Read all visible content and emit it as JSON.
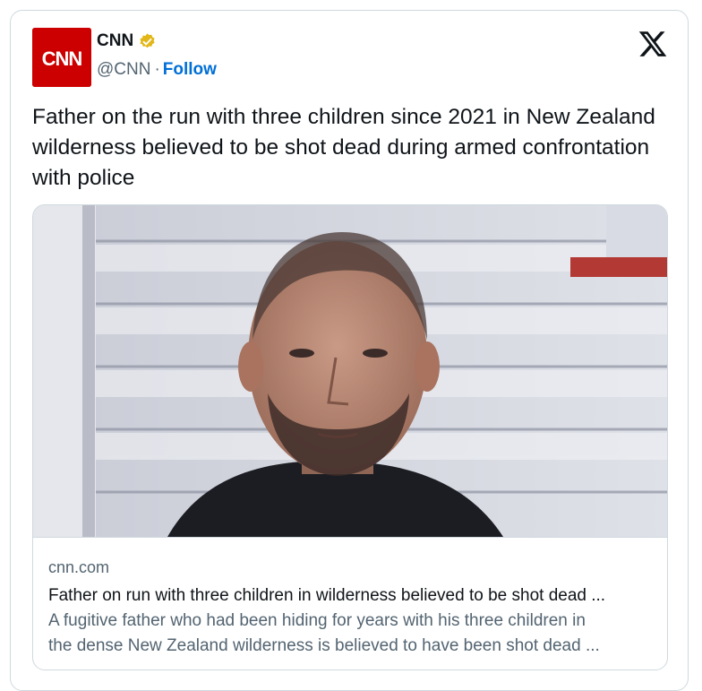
{
  "tweet": {
    "avatar_icon": "cnn-logo",
    "avatar_text": "CNN",
    "display_name": "CNN",
    "verified_icon": "verified-badge-icon",
    "handle": "@CNN",
    "separator": "·",
    "follow_label": "Follow",
    "platform_icon": "x-logo-icon",
    "text": "Father on the run with three children since 2021 in New Zealand wilderness believed to be shot dead during armed confrontation with police"
  },
  "link_card": {
    "image_icon": "article-photo",
    "domain": "cnn.com",
    "title": "Father on run with three children in wilderness believed to be shot dead ...",
    "description_line1": "A fugitive father who had been hiding for years with his three children in",
    "description_line2": "the dense New Zealand wilderness is believed to have been shot dead ..."
  },
  "colors": {
    "brand_red": "#cc0000",
    "verified_gold": "#e2b719",
    "follow_blue": "#006fd6",
    "secondary_text": "#536471",
    "border": "#cfd9de"
  }
}
